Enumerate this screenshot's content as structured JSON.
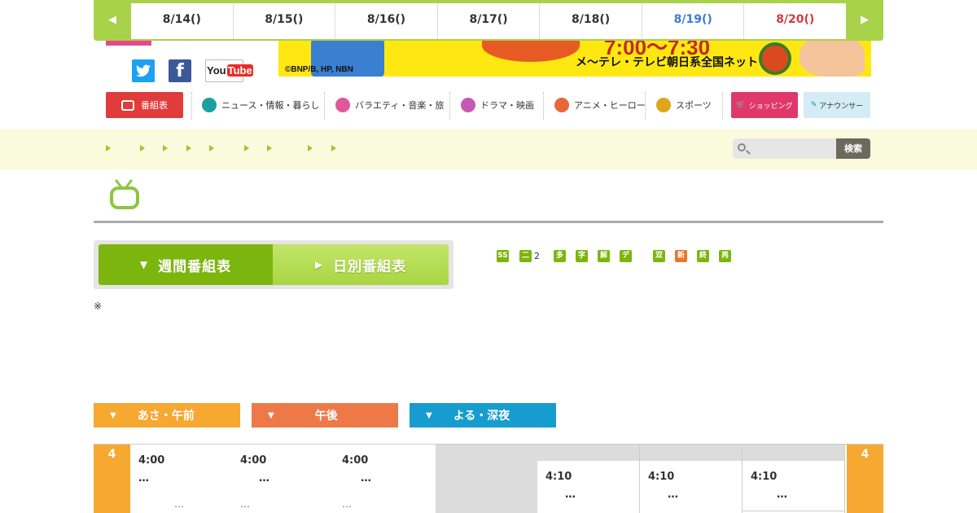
{
  "date_nav": {
    "prev_icon": "triangle-left-icon",
    "next_icon": "triangle-right-icon",
    "days": [
      {
        "label": "8/14()",
        "color": "#333333"
      },
      {
        "label": "8/15()",
        "color": "#333333"
      },
      {
        "label": "8/16()",
        "color": "#333333"
      },
      {
        "label": "8/17()",
        "color": "#333333"
      },
      {
        "label": "8/18()",
        "color": "#333333"
      },
      {
        "label": "8/19()",
        "color": "#3a7bd5"
      },
      {
        "label": "8/20()",
        "color": "#d93a3a"
      }
    ]
  },
  "social": {
    "youtube_label_a": "You",
    "youtube_label_b": "Tube"
  },
  "banner": {
    "time": "7:00～7:30",
    "network": "メ～テレ・テレビ朝日系全国ネット",
    "copyright": "©BNP/B, HP, NBN"
  },
  "categories": [
    {
      "label": "番組表",
      "icon": "tv-icon"
    },
    {
      "label": "ニュース・情報・暮らし",
      "icon": "news-icon",
      "color": "#1aa0a0"
    },
    {
      "label": "バラエティ・音楽・旅",
      "icon": "music-note-icon",
      "color": "#e0589c"
    },
    {
      "label": "ドラマ・映画",
      "icon": "film-icon",
      "color": "#c45ab5"
    },
    {
      "label": "アニメ・ヒーロー",
      "icon": "anime-icon",
      "color": "#e8673a"
    },
    {
      "label": "スポーツ",
      "icon": "sports-icon",
      "color": "#e0a61a"
    },
    {
      "label": "ショッピング",
      "icon": "cart-icon"
    },
    {
      "label": "アナウンサー",
      "icon": "microphone-icon"
    }
  ],
  "search": {
    "placeholder": "",
    "button_label": "検索"
  },
  "tabs": {
    "weekly": "週間番組表",
    "daily": "日別番組表"
  },
  "legend": {
    "badges": [
      "SS",
      "二",
      "多",
      "字",
      "解",
      "デ",
      "双",
      "新",
      "終",
      "再"
    ],
    "number": "2"
  },
  "note": "※",
  "time_bands": {
    "morning": "あさ・午前",
    "afternoon": "午後",
    "night": "よる・深夜"
  },
  "schedule": {
    "hour": "4",
    "columns": [
      {
        "time": "4:00",
        "entry1": "…",
        "entry2": "…"
      },
      {
        "time": "4:00",
        "entry1": "…",
        "entry2": "…"
      },
      {
        "time": "4:00",
        "entry1": "…",
        "entry2": "…"
      },
      {
        "time": "",
        "entry1": "",
        "entry2": ""
      },
      {
        "time": "4:10",
        "entry1": "…",
        "entry2": ""
      },
      {
        "time": "4:10",
        "entry1": "…",
        "entry2": ""
      },
      {
        "time": "4:10",
        "entry1": "…",
        "entry2": ""
      }
    ]
  }
}
